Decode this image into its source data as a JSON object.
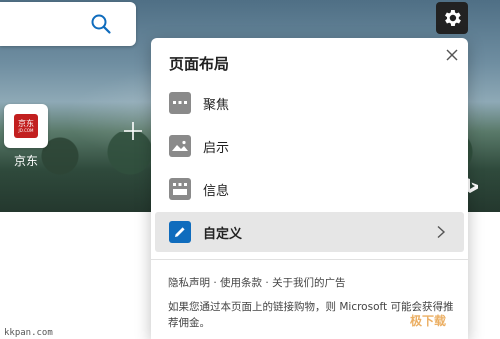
{
  "colors": {
    "accent": "#0f6cbd",
    "tile_brand": "#c21f1f",
    "option_icon_gray": "#8a8a8a",
    "selected_bg": "#e6e6e6"
  },
  "tiles": [
    {
      "label": "京东",
      "logo_text": "京东",
      "logo_sub": "JD.COM"
    }
  ],
  "panel": {
    "title": "页面布局",
    "options": [
      {
        "label": "聚焦",
        "icon": "focus-layout-icon",
        "selected": false
      },
      {
        "label": "启示",
        "icon": "inspiration-layout-icon",
        "selected": false
      },
      {
        "label": "信息",
        "icon": "info-layout-icon",
        "selected": false
      },
      {
        "label": "自定义",
        "icon": "custom-pencil-icon",
        "selected": true
      }
    ],
    "footer_links": [
      "隐私声明",
      "使用条款",
      "关于我们的广告"
    ],
    "footer_separator": "·",
    "footer_note": "如果您通过本页面上的链接购物，则 Microsoft 可能会获得推荐佣金。"
  },
  "watermarks": {
    "left": "kkpan.com",
    "right": "极下载"
  }
}
